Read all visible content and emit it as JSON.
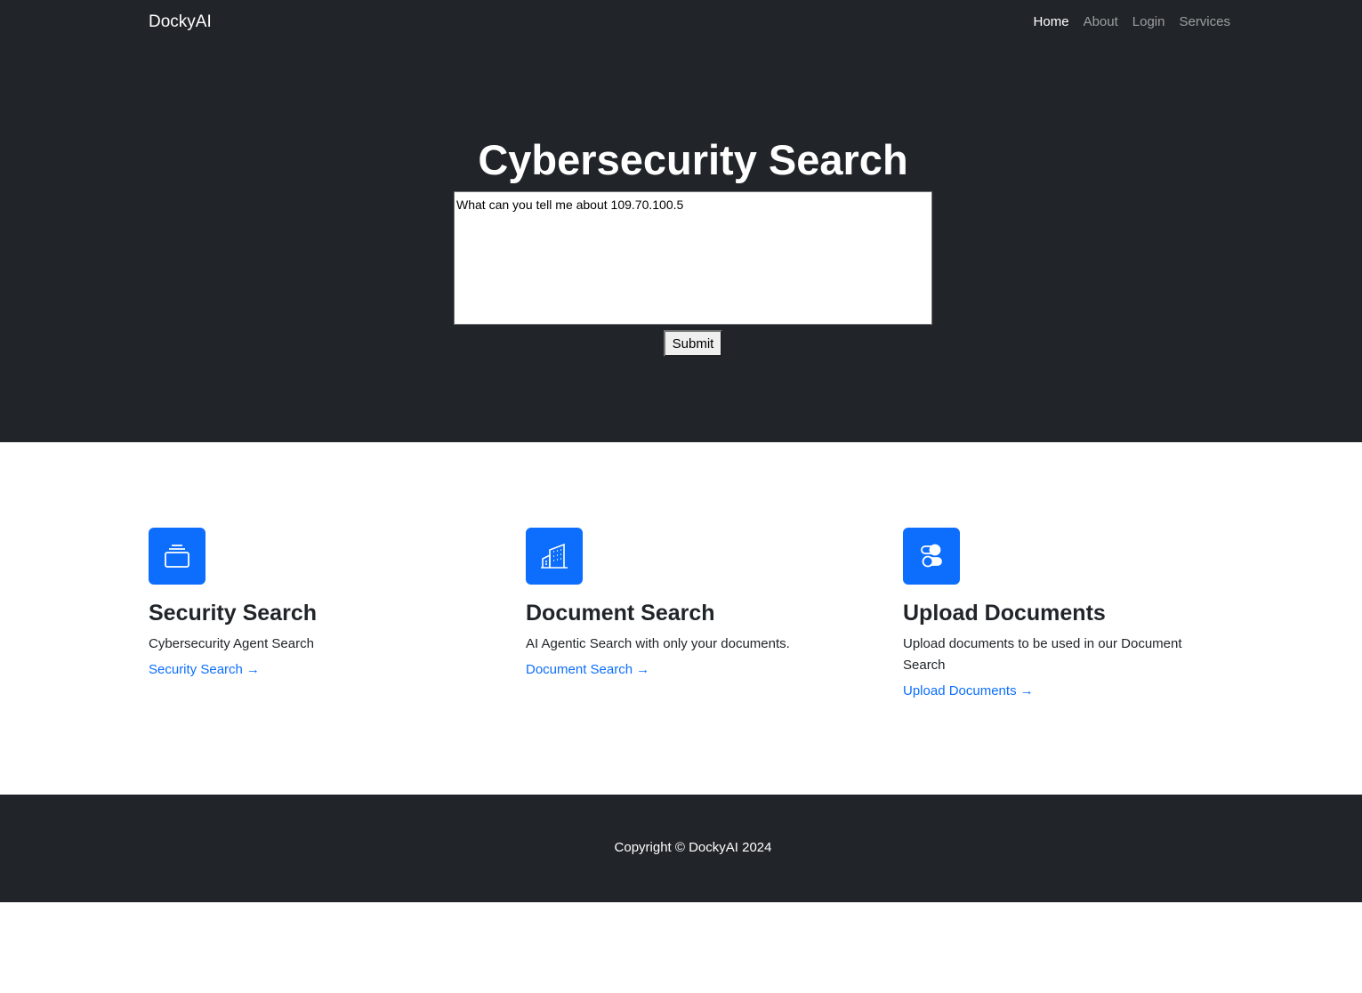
{
  "nav": {
    "brand": "DockyAI",
    "links": [
      "Home",
      "About",
      "Login",
      "Services"
    ],
    "active": "Home"
  },
  "hero": {
    "title": "Cybersecurity Search",
    "query_value": "What can you tell me about 109.70.100.5",
    "submit_label": "Submit"
  },
  "features": [
    {
      "icon": "collection-icon",
      "title": "Security Search",
      "description": "Cybersecurity Agent Search",
      "link": "Security Search"
    },
    {
      "icon": "building-icon",
      "title": "Document Search",
      "description": "AI Agentic Search with only your documents.",
      "link": "Document Search"
    },
    {
      "icon": "toggles-icon",
      "title": "Upload Documents",
      "description": "Upload documents to be used in our Document Search",
      "link": "Upload Documents"
    }
  ],
  "footer": {
    "copyright": "Copyright © DockyAI 2024"
  },
  "colors": {
    "dark": "#212529",
    "primary": "#0d6efd"
  }
}
